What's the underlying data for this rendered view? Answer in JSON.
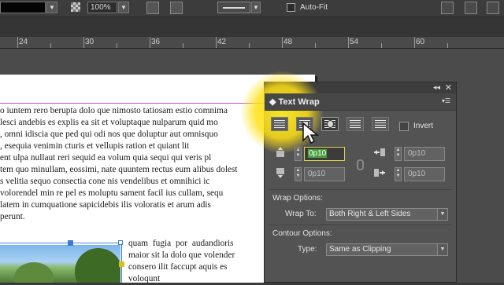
{
  "control_bar": {
    "opacity_value": "100%",
    "auto_fit_label": "Auto-Fit"
  },
  "ruler": {
    "ticks": [
      "24",
      "30",
      "36",
      "42",
      "48",
      "54",
      "60"
    ]
  },
  "document": {
    "body_lines": [
      "o iuntem rero berupta dolo que nimosto tatiosam estio comnima",
      "lesci andebis es explis ea sit et voluptaque nulparum quid mo",
      ", omni idiscia que ped qui odi nos que doluptur aut omnisquo",
      ", esequia venimin cturis et vellupis ration et quiant lit",
      "ent ulpa nullaut reri sequid ea volum quia sequi qui veris pl",
      "tem quo minullam, eossimi, nate quuntem rectus eum alibus dolest",
      "s velitia sequo consectia cone nis vendelibus et omnihici ic",
      "volorendel min re pel es moluptu sament facil ius cullam, sequ",
      "latem in cumquatione sapicidebis ilis voloratis et arum adis",
      "perunt."
    ],
    "wrap_lines": [
      "quam fugia por audandioris",
      "maior sit la dolo que volender",
      "consero ilit faccupt aquis es",
      "voloqunt"
    ]
  },
  "text_wrap_panel": {
    "title": "Text Wrap",
    "collapse_glyph": "◂◂",
    "close_glyph": "✕",
    "menu_glyph": "▾☰",
    "invert_label": "Invert",
    "offsets": {
      "top": "0p10",
      "bottom": "0p10",
      "left": "0p10",
      "right": "0p10"
    },
    "wrap_options_label": "Wrap Options:",
    "wrap_to_label": "Wrap To:",
    "wrap_to_value": "Both Right & Left Sides",
    "contour_options_label": "Contour Options:",
    "type_label": "Type:",
    "type_value": "Same as Clipping"
  },
  "colors": {
    "highlight": "#ffe020",
    "margin_guide": "#d34fd3",
    "frame_blue": "#3a7bd5"
  }
}
